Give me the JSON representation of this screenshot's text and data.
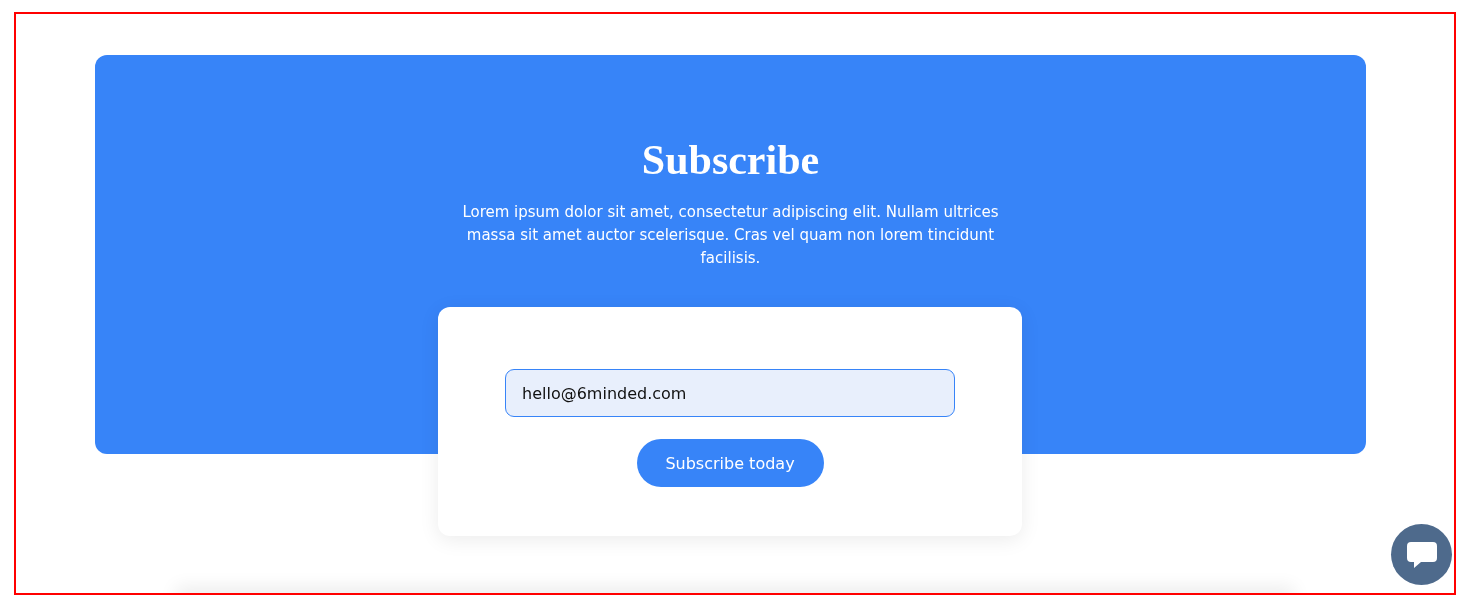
{
  "hero": {
    "title": "Subscribe",
    "text": "Lorem ipsum dolor sit amet, consectetur adipiscing elit. Nullam ultrices massa sit amet auctor scelerisque. Cras vel quam non lorem tincidunt facilisis."
  },
  "form": {
    "email": "hello@6minded.com",
    "button": "Subscribe today"
  }
}
